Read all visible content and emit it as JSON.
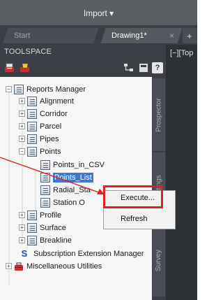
{
  "ribbon": {
    "import_label": "Import ▾"
  },
  "tabs": [
    {
      "label": "Start"
    },
    {
      "label": "Drawing1*",
      "close": "×"
    },
    {
      "label": "+"
    }
  ],
  "toolspace": {
    "title": "TOOLSPACE",
    "help": "?"
  },
  "side_tabs": [
    "Prospector",
    "Settings",
    "Survey"
  ],
  "tree": [
    {
      "label": "Reports Manager",
      "expander": "−"
    },
    {
      "label": "Alignment",
      "expander": "+"
    },
    {
      "label": "Corridor",
      "expander": "+"
    },
    {
      "label": "Parcel",
      "expander": "+"
    },
    {
      "label": "Pipes",
      "expander": "+"
    },
    {
      "label": "Points",
      "expander": "−"
    },
    {
      "label": "Points_in_CSV",
      "expander": ""
    },
    {
      "label": "Points_List",
      "expander": ""
    },
    {
      "label": "Radial_Sta",
      "expander": ""
    },
    {
      "label": "Station O",
      "expander": ""
    },
    {
      "label": "Profile",
      "expander": "+"
    },
    {
      "label": "Surface",
      "expander": "+"
    },
    {
      "label": "Breakline",
      "expander": "+"
    },
    {
      "label": "Subscription Extension Manager",
      "expander": "",
      "icon_letter": "S"
    },
    {
      "label": "Miscellaneous Utilities",
      "expander": "+"
    }
  ],
  "viewport": {
    "label": "[−][Top"
  },
  "context_menu": {
    "items": [
      {
        "label": "Execute..."
      },
      {
        "label": "Refresh"
      }
    ]
  },
  "colors": {
    "highlight": "#e02020",
    "selection": "#3d77d6"
  }
}
